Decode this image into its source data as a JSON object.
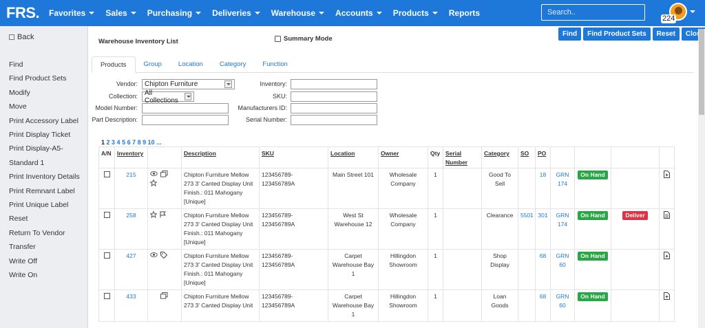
{
  "app": {
    "logo": "FRS."
  },
  "nav": {
    "items": [
      "Favorites",
      "Sales",
      "Purchasing",
      "Deliveries",
      "Warehouse",
      "Accounts",
      "Products",
      "Reports"
    ],
    "search_placeholder": "Search..",
    "notification_count": "224"
  },
  "sidebar": {
    "back": "Back",
    "items": [
      "Find",
      "Find Product Sets",
      "Modify",
      "Move",
      "Print Accessory Label",
      "Print Display Ticket",
      "Print Display-A5-",
      "Standard 1",
      "Print Inventory Details",
      "Print Remnant Label",
      "Print Unique Label",
      "Reset",
      "Return To Vendor",
      "Transfer",
      "Write Off",
      "Write On"
    ]
  },
  "header": {
    "title": "Warehouse Inventory List",
    "summary_mode": "Summary Mode",
    "buttons": [
      "Find",
      "Find Product Sets",
      "Reset",
      "Close"
    ]
  },
  "tabs": [
    "Products",
    "Group",
    "Location",
    "Category",
    "Function"
  ],
  "filters": {
    "vendor_label": "Vendor:",
    "vendor_value": "Chipton Furniture",
    "collection_label": "Collection:",
    "collection_value": "All Collections",
    "model_label": "Model Number:",
    "part_label": "Part Description:",
    "inventory_label": "Inventory:",
    "sku_label": "SKU:",
    "mfr_label": "Manufacturers ID:",
    "serial_label": "Serial Number:"
  },
  "pagination": {
    "pages": [
      "1",
      "2",
      "3",
      "4",
      "5",
      "6",
      "7",
      "8",
      "9",
      "10",
      "..."
    ]
  },
  "table": {
    "headers": [
      "A/N",
      "Inventory",
      "",
      "Description",
      "SKU",
      "Location",
      "Owner",
      "Qty",
      "Serial Number",
      "Category",
      "SO",
      "PO",
      "",
      "",
      "",
      ""
    ],
    "rows": [
      {
        "inventory": "215",
        "icons": [
          "eye-icon",
          "gallery-icon",
          "star-icon"
        ],
        "description": "Chipton Furniture   Mellow 273   3' Canted Display Unit Finish.: 011 Mahogany [Unique]",
        "sku": "123456789-123456789A",
        "location": "Main Street 101",
        "owner": "Wholesale Company",
        "qty": "1",
        "serial": "",
        "category": "Good To Sell",
        "so": "",
        "po": "18",
        "grn": "GRN 174",
        "status": "On Hand",
        "deliver": "",
        "doc": "file-plus-icon"
      },
      {
        "inventory": "258",
        "icons": [
          "star-icon",
          "flag-icon"
        ],
        "description": "Chipton Furniture   Mellow 273   3' Canted Display Unit Finish.: 011 Mahogany [Unique]",
        "sku": "123456789-123456789A",
        "location": "West St Warehouse 12",
        "owner": "Wholesale Company",
        "qty": "1",
        "serial": "",
        "category": "Clearance",
        "so": "5501",
        "po": "301",
        "grn": "GRN 174",
        "status": "On Hand",
        "deliver": "Deliver",
        "doc": "file-text-icon"
      },
      {
        "inventory": "427",
        "icons": [
          "eye-icon",
          "tag-icon"
        ],
        "description": "Chipton Furniture   Mellow 273   3' Canted Display Unit Finish.: 011 Mahogany [Unique]",
        "sku": "123456789-123456789A",
        "location": "Carpet Warehouse Bay 1",
        "owner": "Hillingdon Showroom",
        "qty": "1",
        "serial": "",
        "category": "Shop Display",
        "so": "",
        "po": "68",
        "grn": "GRN 60",
        "status": "On Hand",
        "deliver": "",
        "doc": "file-plus-icon"
      },
      {
        "inventory": "433",
        "icons": [
          "gallery-icon"
        ],
        "description": "Chipton Furniture   Mellow 273   3' Canted Display Unit",
        "sku": "123456789-123456789A",
        "location": "Carpet Warehouse Bay 1",
        "owner": "Hillingdon Showroom",
        "qty": "1",
        "serial": "",
        "category": "Loan Goods",
        "so": "",
        "po": "68",
        "grn": "GRN 60",
        "status": "On Hand",
        "deliver": "",
        "doc": "file-plus-icon"
      }
    ]
  },
  "colors": {
    "primary": "#1e78d9",
    "success": "#28a745",
    "danger": "#dc3545"
  }
}
